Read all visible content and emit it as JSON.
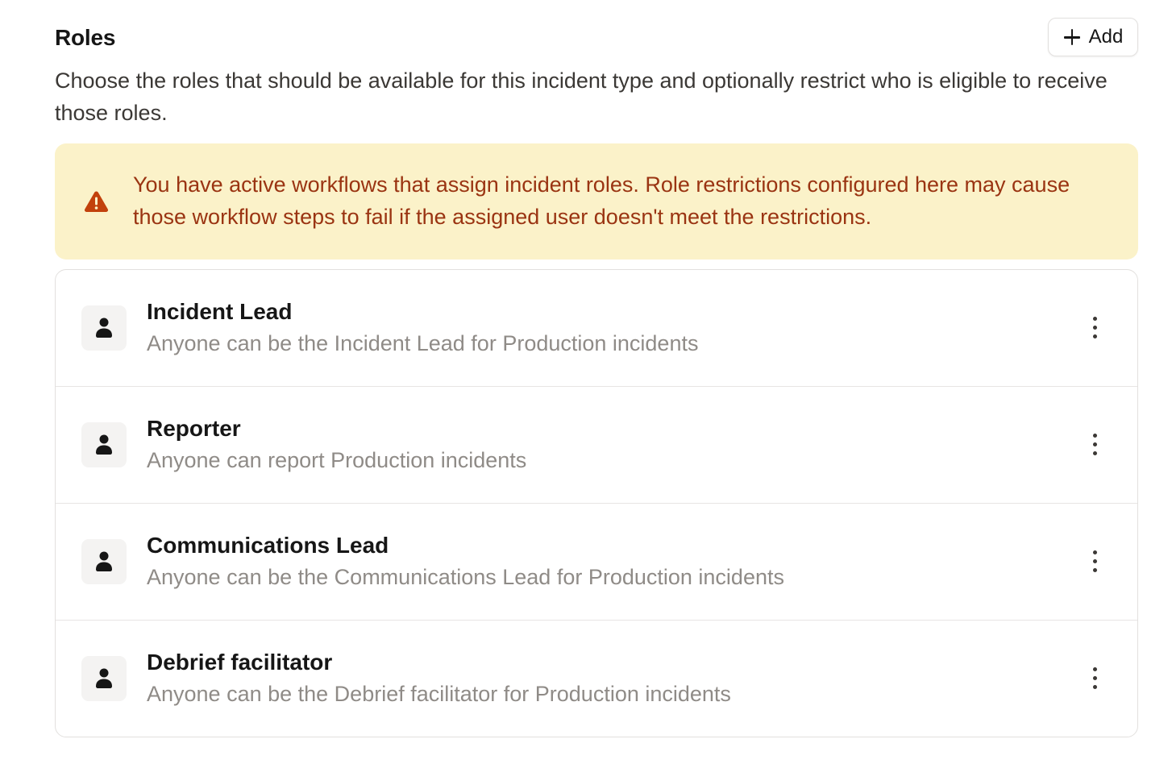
{
  "roles_section": {
    "title": "Roles",
    "add_button_label": "Add",
    "description": "Choose the roles that should be available for this incident type and optionally restrict who is eligible to receive those roles.",
    "warning": {
      "icon": "warning-triangle-icon",
      "text": "You have active workflows that assign incident roles. Role restrictions configured here may cause those workflow steps to fail if the assigned user doesn't meet the restrictions."
    }
  },
  "roles": [
    {
      "name": "Incident Lead",
      "description": "Anyone can be the Incident Lead for Production incidents",
      "icon": "user-icon"
    },
    {
      "name": "Reporter",
      "description": "Anyone can report Production incidents",
      "icon": "user-icon"
    },
    {
      "name": "Communications Lead",
      "description": "Anyone can be the Communications Lead for Production incidents",
      "icon": "user-icon"
    },
    {
      "name": "Debrief facilitator",
      "description": "Anyone can be the Debrief facilitator for Production incidents",
      "icon": "user-icon"
    }
  ],
  "colors": {
    "warning_background": "#fbf2c9",
    "warning_text": "#9a3412",
    "warning_icon": "#c2410c",
    "muted_text": "#8f8b87"
  }
}
